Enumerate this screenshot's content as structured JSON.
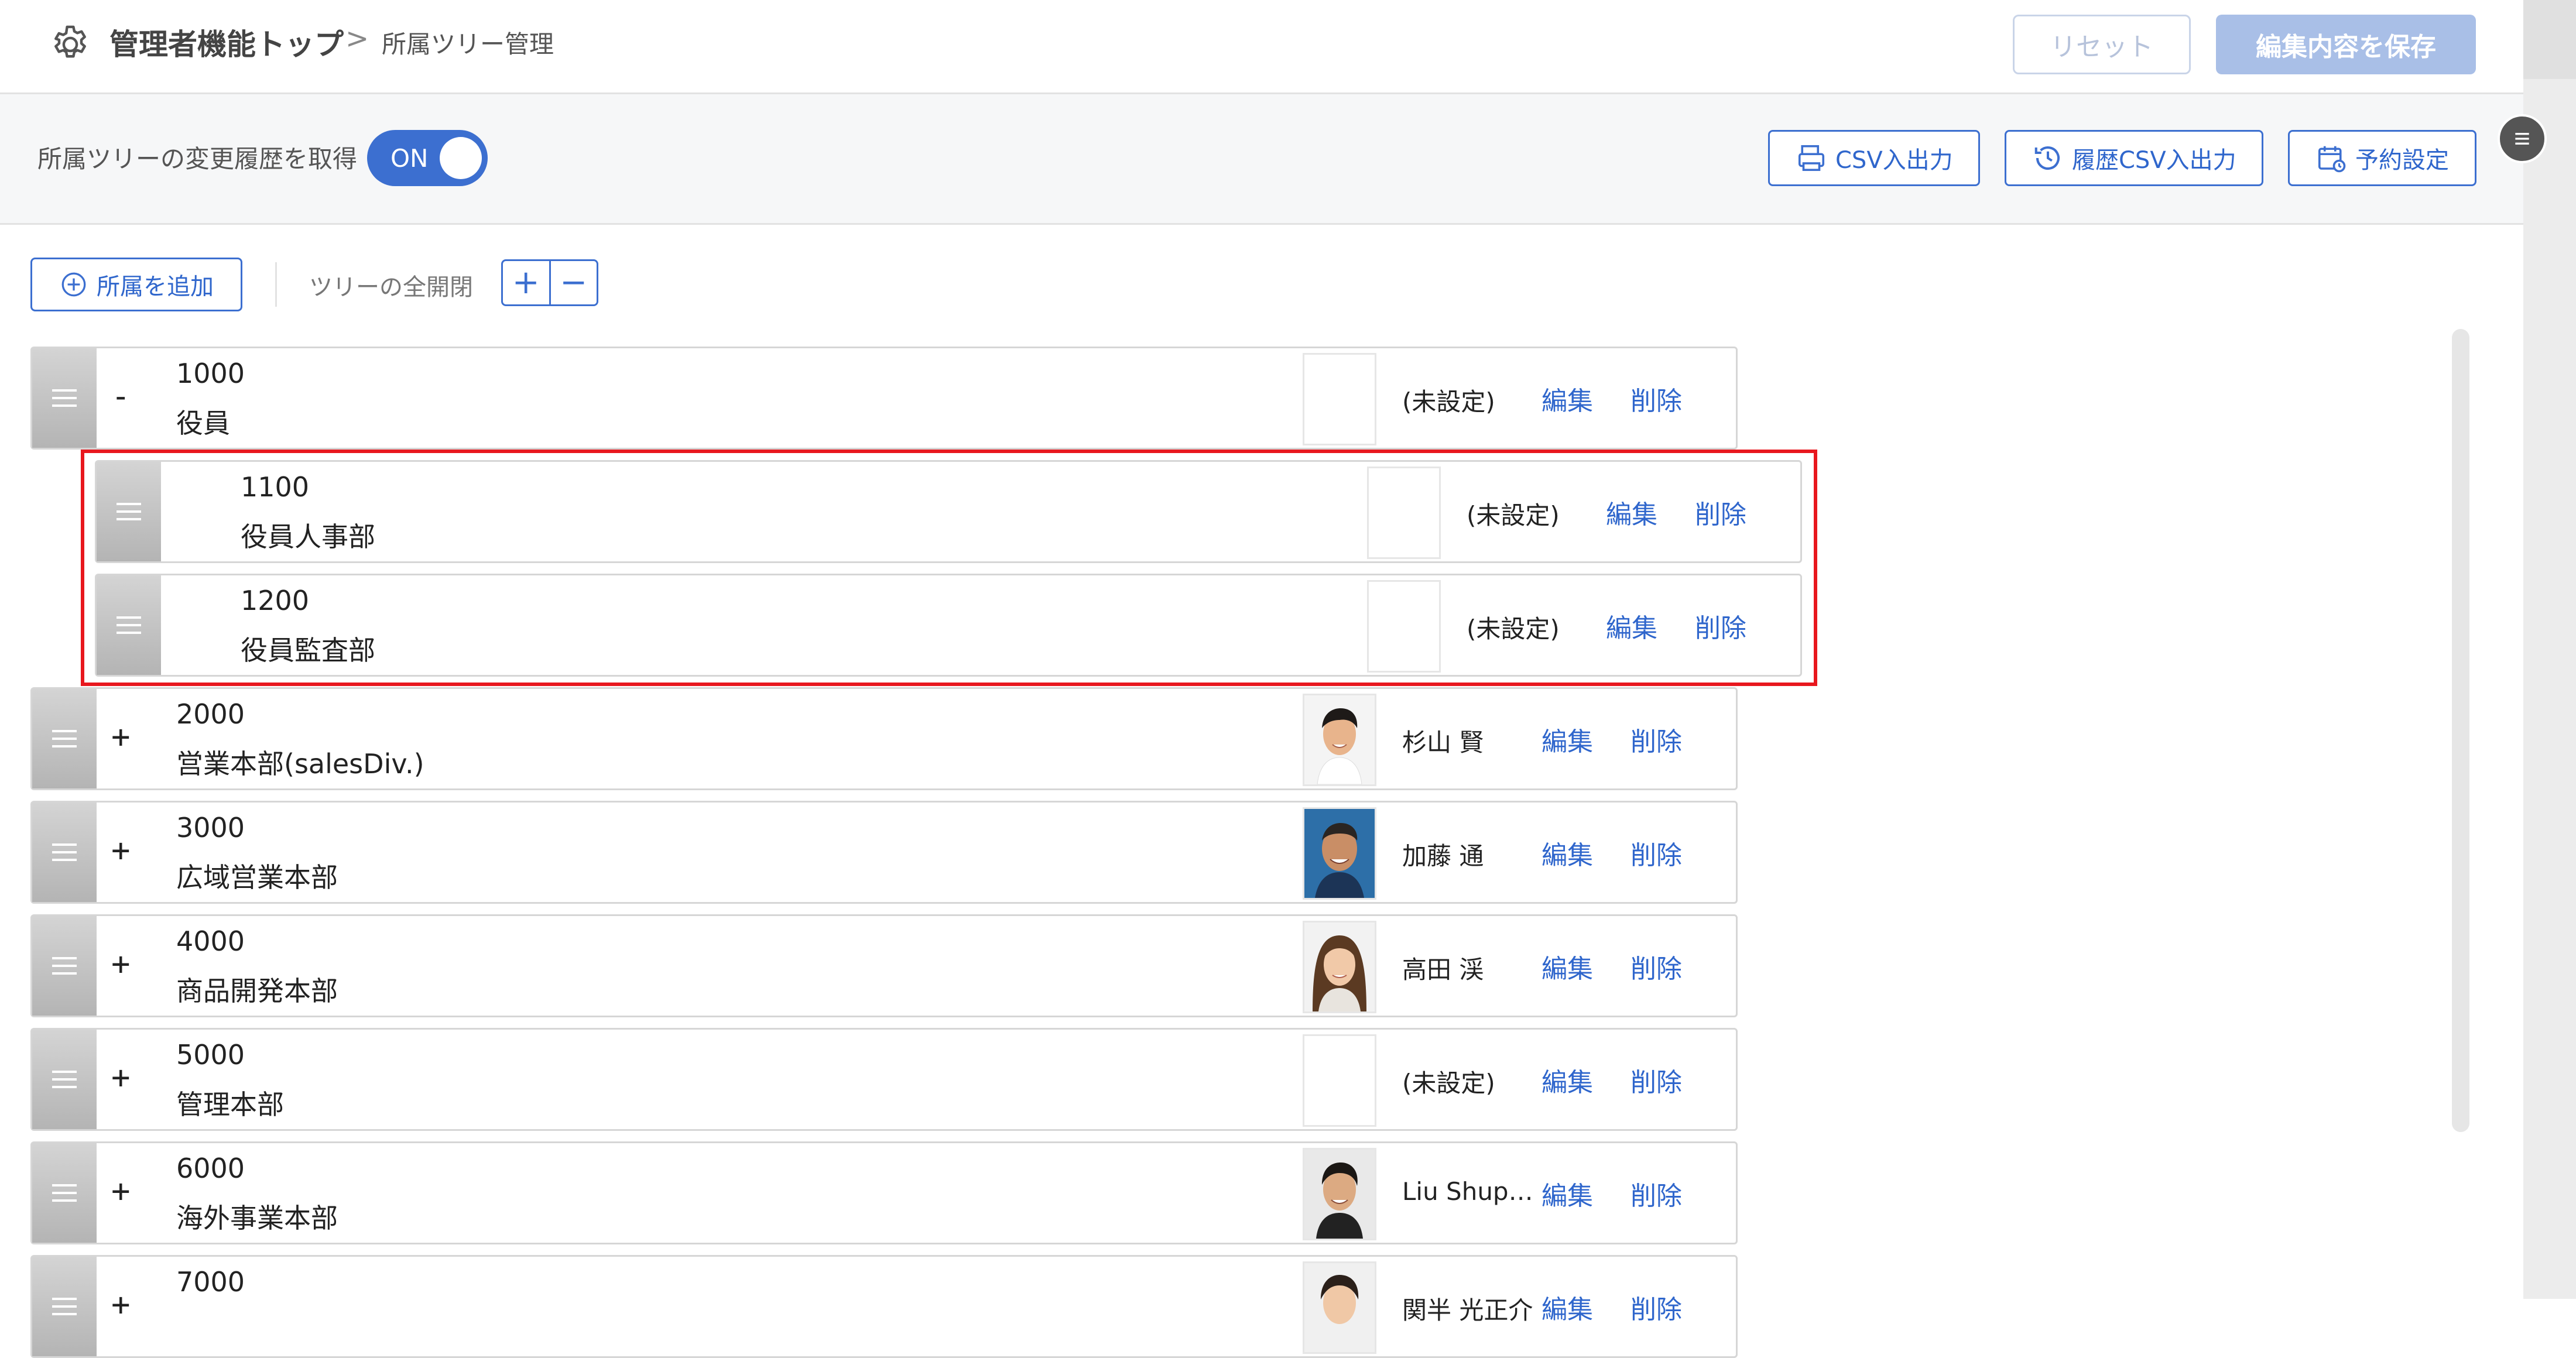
{
  "header": {
    "top_label": "管理者機能トップ",
    "separator": ">",
    "current_label": "所属ツリー管理",
    "reset_label": "リセット",
    "save_label": "編集内容を保存"
  },
  "toolbar": {
    "history_label": "所属ツリーの変更履歴を取得",
    "toggle_label": "ON",
    "csv_label": "CSV入出力",
    "history_csv_label": "履歴CSV入出力",
    "schedule_label": "予約設定"
  },
  "tree_controls": {
    "add_label": "所属を追加",
    "expand_label": "ツリーの全開閉",
    "expand_plus": "+",
    "collapse_minus": "−"
  },
  "rows": [
    {
      "sign": "-",
      "code": "1000",
      "name": "役員",
      "manager": "(未設定)",
      "photo": "none",
      "edit": "編集",
      "del": "削除"
    },
    {
      "sign": "",
      "code": "1100",
      "name": "役員人事部",
      "manager": "(未設定)",
      "photo": "none",
      "edit": "編集",
      "del": "削除"
    },
    {
      "sign": "",
      "code": "1200",
      "name": "役員監査部",
      "manager": "(未設定)",
      "photo": "none",
      "edit": "編集",
      "del": "削除"
    },
    {
      "sign": "+",
      "code": "2000",
      "name": "営業本部(salesDiv.)",
      "manager": "杉山 賢",
      "photo": "man",
      "edit": "編集",
      "del": "削除"
    },
    {
      "sign": "+",
      "code": "3000",
      "name": "広域営業本部",
      "manager": "加藤 通",
      "photo": "man",
      "edit": "編集",
      "del": "削除"
    },
    {
      "sign": "+",
      "code": "4000",
      "name": "商品開発本部",
      "manager": "高田 渓",
      "photo": "woman",
      "edit": "編集",
      "del": "削除"
    },
    {
      "sign": "+",
      "code": "5000",
      "name": "管理本部",
      "manager": "(未設定)",
      "photo": "none",
      "edit": "編集",
      "del": "削除"
    },
    {
      "sign": "+",
      "code": "6000",
      "name": "海外事業本部",
      "manager": "Liu Shup…",
      "photo": "man",
      "edit": "編集",
      "del": "削除"
    },
    {
      "sign": "+",
      "code": "7000",
      "name": "",
      "manager": "関半 光正介",
      "photo": "woman",
      "edit": "編集",
      "del": "削除"
    }
  ],
  "colors": {
    "accent": "#3c6fd0",
    "highlight": "#e8171e"
  }
}
